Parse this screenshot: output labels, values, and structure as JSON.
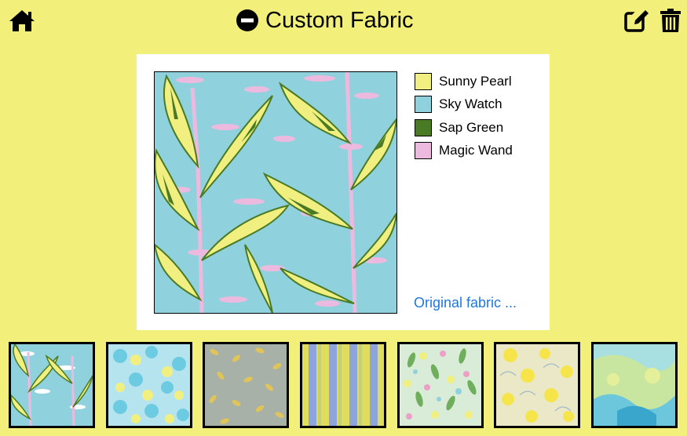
{
  "header": {
    "title": "Custom Fabric",
    "icons": {
      "home": "home-icon",
      "title": "minus-circle-icon",
      "edit": "edit-icon",
      "trash": "trash-icon"
    }
  },
  "palette": [
    {
      "name": "Sunny Pearl",
      "color": "#f1ef7f"
    },
    {
      "name": "Sky Watch",
      "color": "#8fd2de"
    },
    {
      "name": "Sap Green",
      "color": "#4a7a23"
    },
    {
      "name": "Magic Wand",
      "color": "#edbadf"
    }
  ],
  "original_link": "Original fabric ...",
  "colors": {
    "background": "#f2f07a",
    "link": "#1f77e0"
  }
}
